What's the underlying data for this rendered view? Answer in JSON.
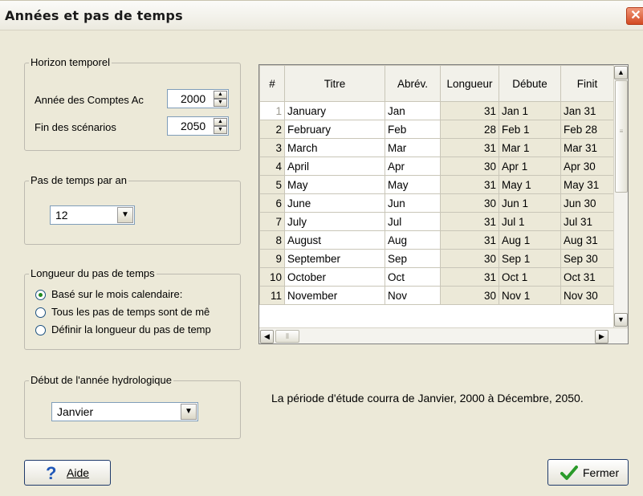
{
  "window": {
    "title": "Années et pas de temps",
    "close_glyph": "✕"
  },
  "horizon": {
    "legend": "Horizon temporel",
    "year_label": "Année des Comptes Ac",
    "year_value": "2000",
    "end_label": "Fin des scénarios",
    "end_value": "2050"
  },
  "timesteps_per_year": {
    "legend": "Pas de temps par an",
    "value": "12"
  },
  "step_length": {
    "legend": "Longueur du pas de temps",
    "options": [
      {
        "label": "Basé sur le mois calendaire:",
        "selected": true
      },
      {
        "label": "Tous les pas de temps sont de mê",
        "selected": false
      },
      {
        "label": "Définir la longueur du pas de temp",
        "selected": false
      }
    ]
  },
  "hydro_year": {
    "legend": "Début de l'année hydrologique",
    "value": "Janvier"
  },
  "table": {
    "headers": [
      "#",
      "Titre",
      "Abrév.",
      "Longueur",
      "Débute",
      "Finit"
    ],
    "rows": [
      [
        "1",
        "January",
        "Jan",
        "31",
        "Jan 1",
        "Jan 31"
      ],
      [
        "2",
        "February",
        "Feb",
        "28",
        "Feb 1",
        "Feb 28"
      ],
      [
        "3",
        "March",
        "Mar",
        "31",
        "Mar 1",
        "Mar 31"
      ],
      [
        "4",
        "April",
        "Apr",
        "30",
        "Apr 1",
        "Apr 30"
      ],
      [
        "5",
        "May",
        "May",
        "31",
        "May 1",
        "May 31"
      ],
      [
        "6",
        "June",
        "Jun",
        "30",
        "Jun 1",
        "Jun 30"
      ],
      [
        "7",
        "July",
        "Jul",
        "31",
        "Jul 1",
        "Jul 31"
      ],
      [
        "8",
        "August",
        "Aug",
        "31",
        "Aug 1",
        "Aug 31"
      ],
      [
        "9",
        "September",
        "Sep",
        "30",
        "Sep 1",
        "Sep 30"
      ],
      [
        "10",
        "October",
        "Oct",
        "31",
        "Oct 1",
        "Oct 31"
      ],
      [
        "11",
        "November",
        "Nov",
        "30",
        "Nov 1",
        "Nov 30"
      ]
    ]
  },
  "study_period_text": "La période d'étude courra de Janvier, 2000 à Décembre, 2050.",
  "buttons": {
    "help": "Aide",
    "close": "Fermer"
  },
  "colors": {
    "help_icon": "#1f57b8",
    "check_icon": "#2a9a2a",
    "close_button": "#d34a23"
  },
  "icons": {
    "help": "question-mark-icon",
    "close": "checkmark-icon",
    "window_close": "close-icon"
  }
}
